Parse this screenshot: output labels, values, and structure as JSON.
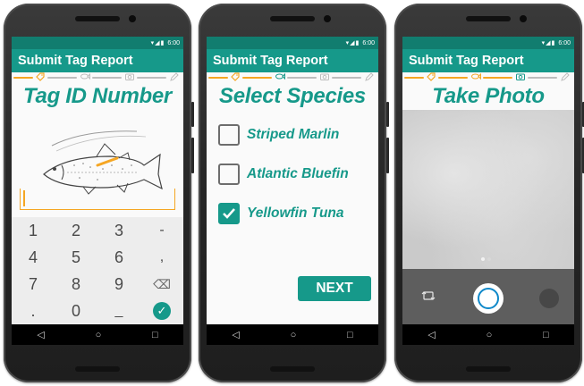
{
  "status_bar": {
    "time": "6:00",
    "icons": "▾◢▮"
  },
  "app_title": "Submit Tag Report",
  "colors": {
    "teal": "#16998a",
    "teal_dark": "#117d6f",
    "orange": "#f5a623",
    "gray": "#bdbdbd"
  },
  "stepper_icons": [
    "tag-icon",
    "fish-icon",
    "camera-icon",
    "pencil-icon"
  ],
  "screen1": {
    "heading": "Tag ID Number",
    "keypad": [
      [
        "1",
        "2",
        "3",
        "-"
      ],
      [
        "4",
        "5",
        "6",
        ","
      ],
      [
        "7",
        "8",
        "9",
        "⌫"
      ],
      [
        ".",
        "0",
        "_",
        "✓"
      ]
    ]
  },
  "screen2": {
    "heading": "Select Species",
    "species": [
      {
        "label": "Striped Marlin",
        "checked": false
      },
      {
        "label": "Atlantic Bluefin",
        "checked": false
      },
      {
        "label": "Yellowfin Tuna",
        "checked": true
      }
    ],
    "next_label": "NEXT"
  },
  "screen3": {
    "heading": "Take Photo"
  },
  "nav": {
    "back": "◁",
    "home": "○",
    "recents": "□"
  }
}
